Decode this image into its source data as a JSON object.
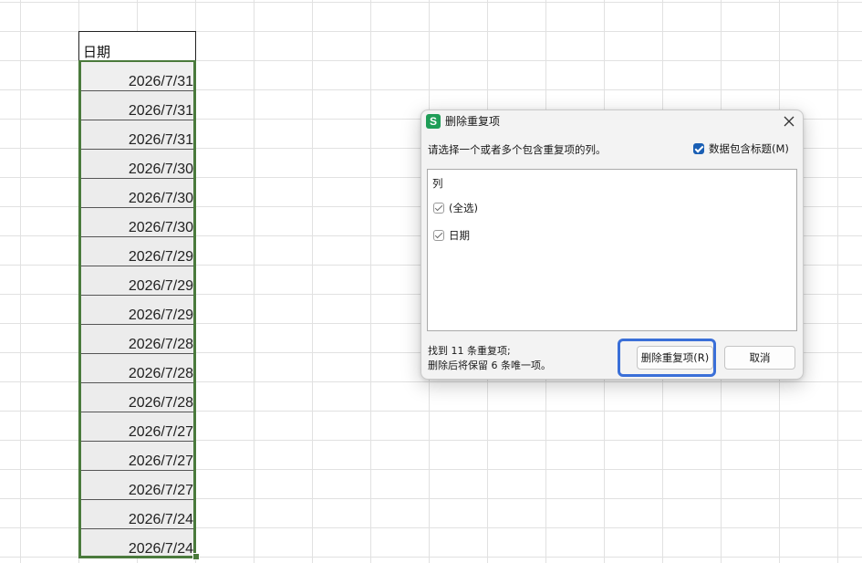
{
  "sheet": {
    "column_header": "日期",
    "dates": [
      "2026/7/31",
      "2026/7/31",
      "2026/7/31",
      "2026/7/30",
      "2026/7/30",
      "2026/7/30",
      "2026/7/29",
      "2026/7/29",
      "2026/7/29",
      "2026/7/28",
      "2026/7/28",
      "2026/7/28",
      "2026/7/27",
      "2026/7/27",
      "2026/7/27",
      "2026/7/24",
      "2026/7/24"
    ]
  },
  "dialog": {
    "app_icon_letter": "S",
    "title": "删除重复项",
    "prompt": "请选择一个或者多个包含重复项的列。",
    "header_checkbox_label": "数据包含标题(M)",
    "list_header": "列",
    "items": [
      {
        "label": "(全选)",
        "checked": true
      },
      {
        "label": "日期",
        "checked": true
      }
    ],
    "status_line1": "找到 11 条重复项;",
    "status_line2": "删除后将保留 6 条唯一项。",
    "primary_button": "删除重复项(R)",
    "cancel_button": "取消"
  },
  "colors": {
    "selection_border": "#4a7a3c",
    "checkbox_accent": "#1a5fb4",
    "focus_ring": "#3a6fd8",
    "app_icon": "#1f9d57"
  }
}
